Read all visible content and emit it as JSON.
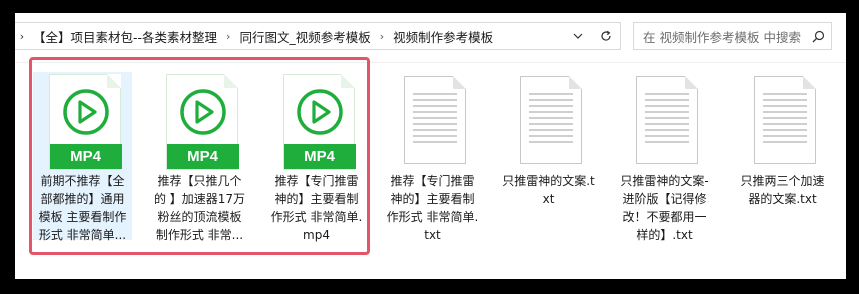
{
  "breadcrumb": {
    "items": [
      "【全】项目素材包--各类素材整理",
      "同行图文_视频参考模板",
      "视频制作参考模板"
    ],
    "separator": "›",
    "lead_arrow": "›",
    "dropdown_icon": "chevron-down-icon",
    "refresh_icon": "refresh-icon"
  },
  "search": {
    "placeholder": "在 视频制作参考模板 中搜索",
    "icon": "search-icon"
  },
  "files": [
    {
      "name": "前期不推荐【全部都推的】通用模板 主要看制作形式 非常简单...",
      "type": "mp4",
      "badge": "MP4",
      "selected": true
    },
    {
      "name": "推荐【只推几个的 】加速器17万粉丝的顶流模板 制作形式 非常...",
      "type": "mp4",
      "badge": "MP4",
      "selected": false
    },
    {
      "name": "推荐【专门推雷神的】主要看制作形式 非常简单.mp4",
      "type": "mp4",
      "badge": "MP4",
      "selected": false
    },
    {
      "name": "推荐【专门推雷神的】主要看制作形式 非常简单.txt",
      "type": "txt",
      "selected": false
    },
    {
      "name": "只推雷神的文案.txt",
      "type": "txt",
      "selected": false
    },
    {
      "name": "只推雷神的文案-进阶版【记得修改！不要都用一样的】.txt",
      "type": "txt",
      "selected": false
    },
    {
      "name": "只推两三个加速器的文案.txt",
      "type": "txt",
      "selected": false
    }
  ],
  "colors": {
    "mp4_green": "#1fae3b",
    "selection_highlight": "#e5f3ff",
    "annotation_frame": "#e5556a"
  }
}
